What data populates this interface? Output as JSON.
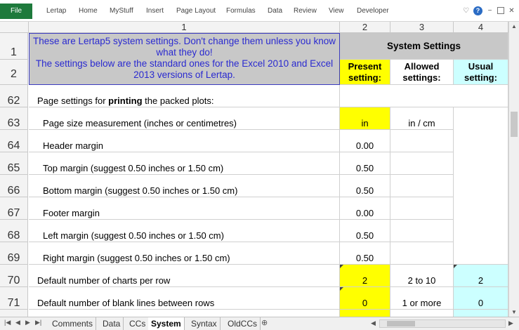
{
  "ribbon": {
    "file": "File",
    "tabs": [
      "Lertap",
      "Home",
      "MyStuff",
      "Insert",
      "Page Layout",
      "Formulas",
      "Data",
      "Review",
      "View",
      "Developer"
    ]
  },
  "columns": [
    "1",
    "2",
    "3",
    "4"
  ],
  "header": {
    "notice": "These are Lertap5 system settings. Don't change them unless you know what they do!\nThe settings below are the standard ones for the Excel 2010 and Excel 2013 versions of Lertap.",
    "system_settings": "System Settings",
    "present": "Present setting:",
    "allowed": "Allowed settings:",
    "usual": "Usual setting:"
  },
  "rows": [
    {
      "num": "1"
    },
    {
      "num": "2"
    },
    {
      "num": "62",
      "label_pre": "Page settings for ",
      "label_bold": "printing",
      "label_post": " the packed plots:",
      "present": "",
      "allowed": "",
      "usual": ""
    },
    {
      "num": "63",
      "label": "Page size measurement (inches or centimetres)",
      "present": "in",
      "allowed": "in / cm",
      "usual": ""
    },
    {
      "num": "64",
      "label": "Header margin",
      "present": "0.00",
      "allowed": "",
      "usual": ""
    },
    {
      "num": "65",
      "label": "Top margin (suggest 0.50 inches or 1.50 cm)",
      "present": "0.50",
      "allowed": "",
      "usual": ""
    },
    {
      "num": "66",
      "label": "Bottom margin (suggest 0.50 inches or 1.50 cm)",
      "present": "0.50",
      "allowed": "",
      "usual": ""
    },
    {
      "num": "67",
      "label": "Footer margin",
      "present": "0.00",
      "allowed": "",
      "usual": ""
    },
    {
      "num": "68",
      "label": "Left margin (suggest 0.50 inches or 1.50 cm)",
      "present": "0.50",
      "allowed": "",
      "usual": ""
    },
    {
      "num": "69",
      "label": "Right margin (suggest 0.50 inches or 1.50 cm)",
      "present": "0.50",
      "allowed": "",
      "usual": ""
    },
    {
      "num": "70",
      "label": "Default number of charts per row",
      "present": "2",
      "allowed": "2 to 10",
      "usual": "2"
    },
    {
      "num": "71",
      "label": "Default number of blank lines between rows",
      "present": "0",
      "allowed": "1 or more",
      "usual": "0"
    }
  ],
  "sheet_tabs": [
    "Comments",
    "Data",
    "CCs",
    "System",
    "Syntax",
    "OldCCs"
  ],
  "active_tab": "System",
  "colors": {
    "file_tab": "#1e7a3c",
    "present_fill": "#ffff00",
    "usual_fill": "#ccffff",
    "notice_text": "#2a2ad0"
  }
}
